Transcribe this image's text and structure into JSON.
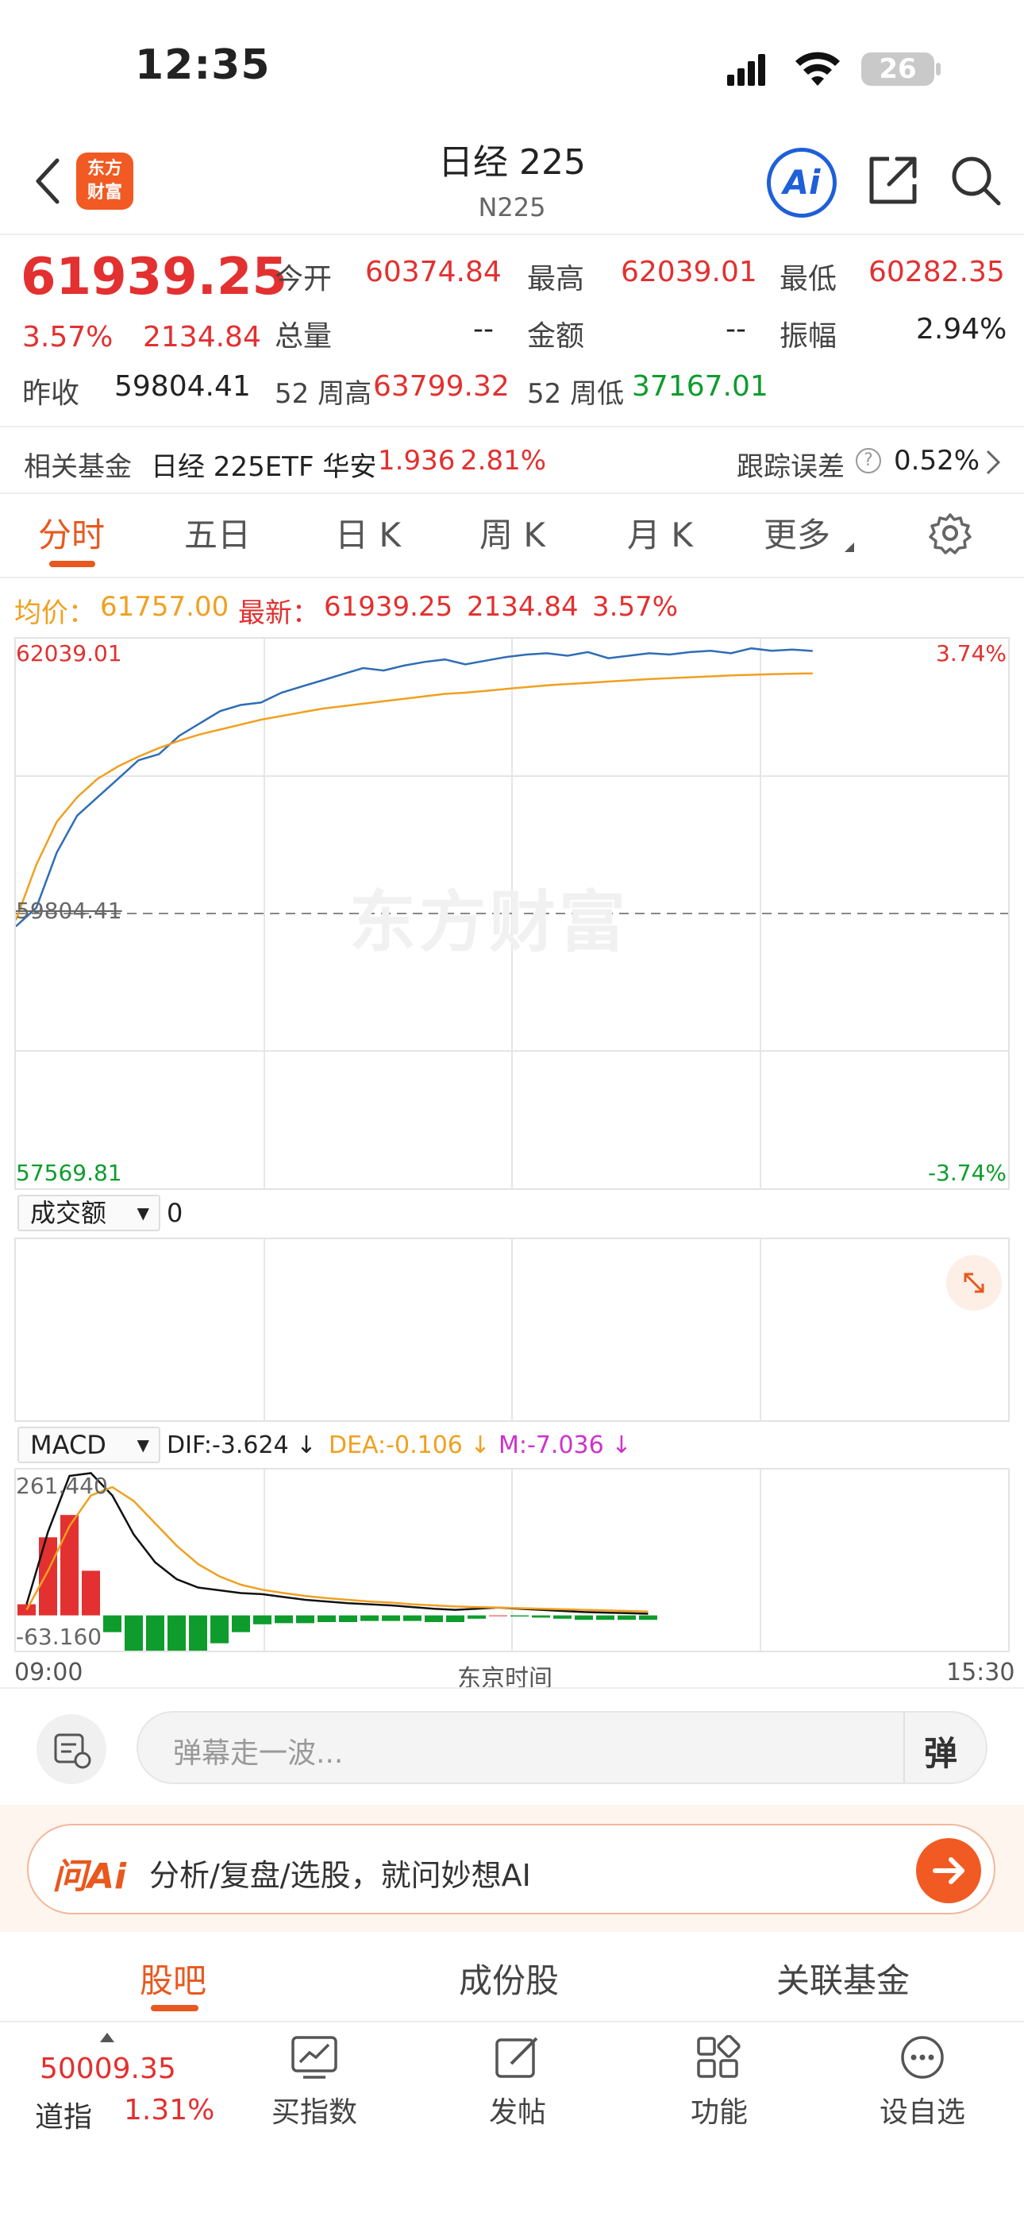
{
  "status": {
    "time": "12:35",
    "battery": "26"
  },
  "header": {
    "logo_text": "东方财富",
    "title": "日经 225",
    "code": "N225",
    "ai_label": "Ai"
  },
  "quote": {
    "price": "61939.25",
    "pct": "3.57%",
    "change": "2134.84",
    "open_label": "今开",
    "open": "60374.84",
    "high_label": "最高",
    "high": "62039.01",
    "low_label": "最低",
    "low": "60282.35",
    "volume_label": "总量",
    "volume": "--",
    "amount_label": "金额",
    "amount": "--",
    "amplitude_label": "振幅",
    "amplitude": "2.94%",
    "prev_close_label": "昨收",
    "prev_close": "59804.41",
    "w52_high_label": "52 周高",
    "w52_high": "63799.32",
    "w52_low_label": "52 周低",
    "w52_low": "37167.01"
  },
  "fund": {
    "label": "相关基金",
    "name": "日经 225ETF 华安",
    "price": "1.936",
    "pct": "2.81%",
    "tracking_label": "跟踪误差",
    "tracking_value": "0.52%"
  },
  "tabs": [
    "分时",
    "五日",
    "日 K",
    "周 K",
    "月 K",
    "更多"
  ],
  "chart_header": {
    "avg_label": "均价：",
    "avg": "61757.00",
    "latest_label": "最新：",
    "latest": "61939.25",
    "latest_change": "2134.84",
    "latest_pct": "3.57%"
  },
  "watermark": "东方财富",
  "chart_data": {
    "type": "line",
    "y_top_label": "62039.01",
    "y_mid_label": "59804.41",
    "y_bottom_label": "57569.81",
    "pct_top_label": "3.74%",
    "pct_bottom_label": "-3.74%",
    "ylim": [
      57569.81,
      62039.01
    ],
    "prev_close": 59804.41,
    "series": [
      {
        "name": "最新",
        "color": "#2f6db5",
        "values": [
          59700,
          59850,
          60300,
          60600,
          60750,
          60900,
          61050,
          61100,
          61250,
          61350,
          61450,
          61500,
          61520,
          61600,
          61650,
          61700,
          61750,
          61800,
          61780,
          61820,
          61850,
          61870,
          61830,
          61860,
          61890,
          61910,
          61920,
          61900,
          61930,
          61880,
          61900,
          61920,
          61910,
          61930,
          61940,
          61920,
          61960,
          61940,
          61950,
          61939
        ]
      },
      {
        "name": "均价",
        "color": "#f0a020",
        "values": [
          59750,
          60200,
          60550,
          60750,
          60900,
          61000,
          61080,
          61150,
          61210,
          61260,
          61300,
          61340,
          61380,
          61410,
          61440,
          61470,
          61490,
          61510,
          61530,
          61550,
          61570,
          61590,
          61600,
          61615,
          61630,
          61645,
          61660,
          61670,
          61680,
          61690,
          61700,
          61710,
          61718,
          61725,
          61732,
          61740,
          61745,
          61750,
          61754,
          61757
        ]
      }
    ]
  },
  "volume_panel": {
    "selector": "成交额",
    "value": "0"
  },
  "macd_panel": {
    "selector": "MACD",
    "dif": "DIF:-3.624 ↓",
    "dea": "DEA:-0.106 ↓",
    "m": "M:-7.036 ↓",
    "y_top": "261.440",
    "y_bottom": "-63.160",
    "time_start": "09:00",
    "time_mid": "东京时间",
    "time_end": "15:30",
    "dif_values": [
      20,
      150,
      250,
      255,
      215,
      145,
      95,
      65,
      50,
      45,
      40,
      38,
      33,
      28,
      25,
      22,
      20,
      18,
      15,
      12,
      10,
      12,
      14,
      12,
      10,
      8,
      6,
      5,
      4,
      3
    ],
    "dea_values": [
      10,
      80,
      160,
      215,
      230,
      205,
      165,
      125,
      92,
      70,
      55,
      46,
      40,
      35,
      31,
      28,
      25,
      23,
      20,
      18,
      16,
      15,
      14,
      13,
      12,
      11,
      10,
      9,
      8,
      7
    ],
    "m_values": [
      20,
      140,
      180,
      80,
      -30,
      -120,
      -140,
      -120,
      -84,
      -50,
      -30,
      -16,
      -14,
      -14,
      -12,
      -12,
      -10,
      -10,
      -10,
      -12,
      -12,
      -6,
      0,
      -2,
      -4,
      -6,
      -8,
      -8,
      -8,
      -8
    ]
  },
  "comment": {
    "placeholder": "弹幕走一波...",
    "danmu": "弹"
  },
  "ai_bar": {
    "logo": "问Ai",
    "text": "分析/复盘/选股，就问妙想AI"
  },
  "bottom_tabs": [
    "股吧",
    "成份股",
    "关联基金"
  ],
  "bottom_nav": {
    "dow_value": "50009.35",
    "dow_label": "道指",
    "dow_pct": "1.31%",
    "items": [
      "买指数",
      "发帖",
      "功能",
      "设自选"
    ]
  }
}
